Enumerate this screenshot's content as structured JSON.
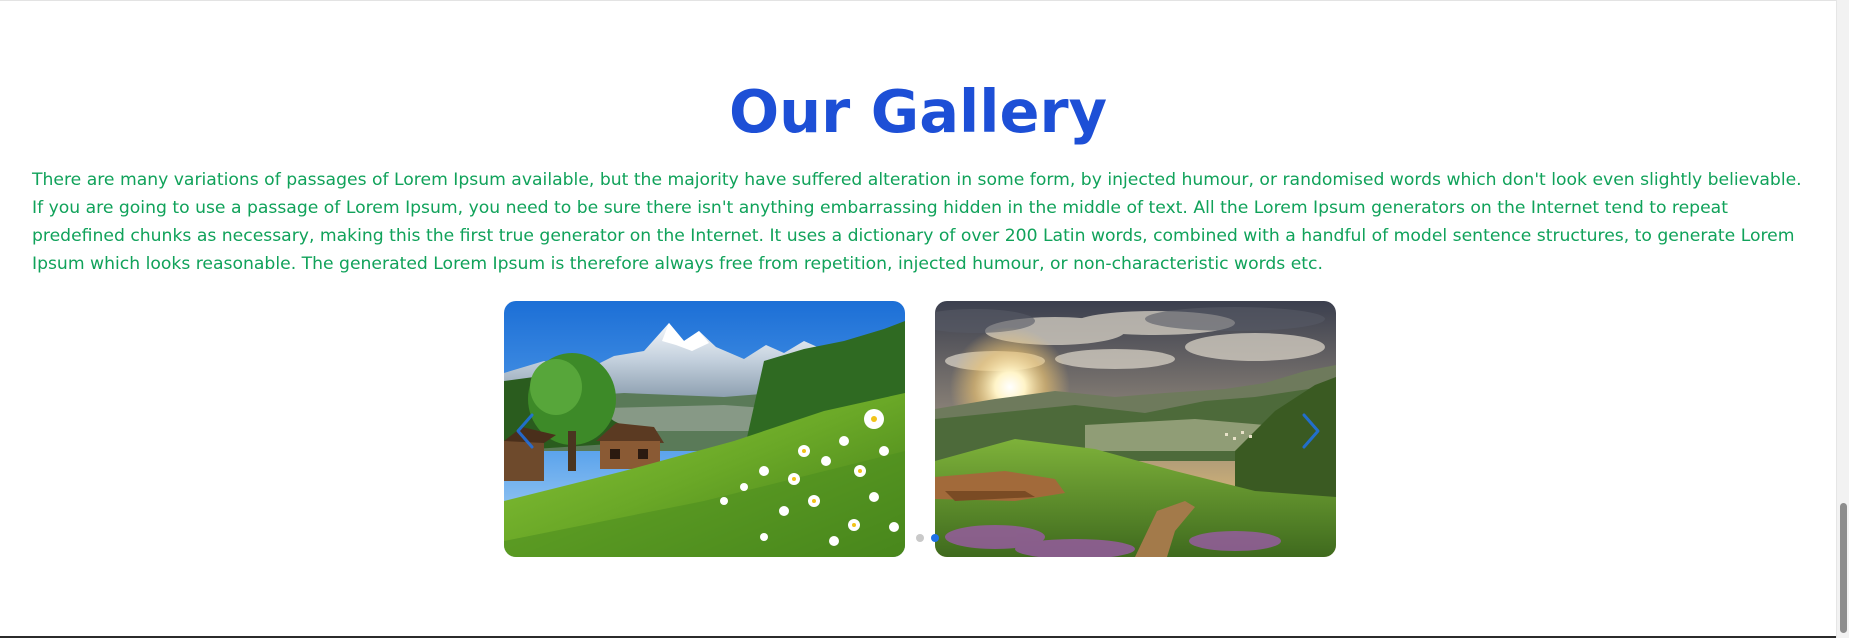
{
  "gallery": {
    "title": "Our Gallery",
    "description": "There are many variations of passages of Lorem Ipsum available, but the majority have suffered alteration in some form, by injected humour, or randomised words which don't look even slightly believable. If you are going to use a passage of Lorem Ipsum, you need to be sure there isn't anything embarrassing hidden in the middle of text. All the Lorem Ipsum generators on the Internet tend to repeat predefined chunks as necessary, making this the first true generator on the Internet. It uses a dictionary of over 200 Latin words, combined with a handful of model sentence structures, to generate Lorem Ipsum which looks reasonable. The generated Lorem Ipsum is therefore always free from repetition, injected humour, or non-characteristic words etc."
  },
  "carousel": {
    "slides": [
      {
        "name": "alpine-meadow-image"
      },
      {
        "name": "valley-sunset-image"
      }
    ],
    "prev_icon": "chevron-left-icon",
    "next_icon": "chevron-right-icon",
    "dot_count": 2,
    "active_dot": 2
  },
  "colors": {
    "title": "#1d4fd6",
    "description": "#10a25a",
    "active_dot": "#1f72e8",
    "inactive_dot": "#c9c9c9"
  }
}
